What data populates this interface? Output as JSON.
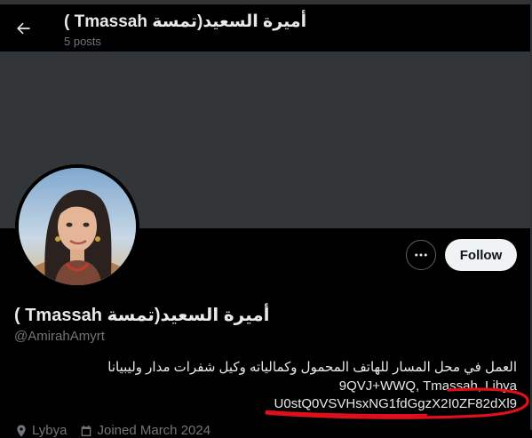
{
  "header": {
    "title": "أميرة السعيد(تمسة Tmassah )",
    "posts": "5 posts"
  },
  "profile": {
    "display_name": "أميرة السعيد(تمسة Tmassah )",
    "handle": "@AmirahAmyrt",
    "follow_label": "Follow",
    "bio_line1": "العمل في محل المسار للهاتف المحمول وكمالياته وكيل شفرات مدار وليبيانا",
    "bio_line2": "9QVJ+WWQ, Tmassah, Libya",
    "bio_line3": "U0stQ0VSVHsxNG1fdGgzX2I0ZF82dXl9",
    "location": "Lybya",
    "joined": "Joined March 2024"
  },
  "icons": {
    "back": "arrow-left-icon",
    "more": "more-horizontal-icon",
    "location": "location-pin-icon",
    "calendar": "calendar-icon"
  },
  "colors": {
    "background": "#000000",
    "banner": "#333639",
    "follow_bg": "#eff3f4",
    "muted": "#71767b",
    "annotation_red": "#e0101a"
  }
}
